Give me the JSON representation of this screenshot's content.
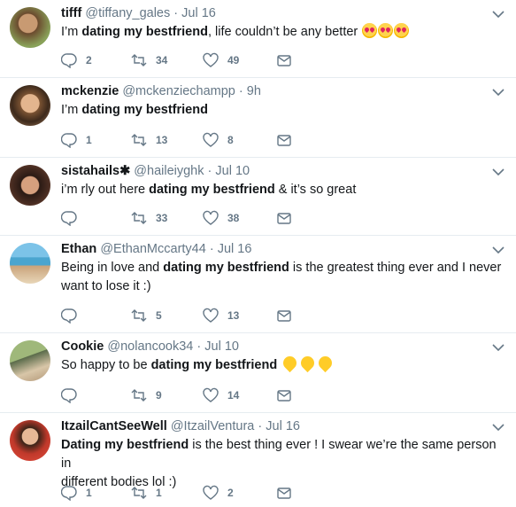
{
  "colors": {
    "accent": "#1da1f2",
    "muted": "#657786",
    "divider": "#e6ecf0",
    "heart_emoji": "#e0245e",
    "yellow_heart": "#ffcc28"
  },
  "tweets": [
    {
      "name": "tifff",
      "handle": "@tiffany_gales",
      "sep": "·",
      "time": "Jul 16",
      "text_before": "I’m ",
      "highlight": "dating my bestfriend",
      "text_after": ", life couldn’t be any better",
      "emoji": [
        "heart-eyes-emoji",
        "heart-eyes-emoji",
        "heart-eyes-emoji"
      ],
      "replies": "2",
      "retweets": "34",
      "likes": "49"
    },
    {
      "name": "mckenzie",
      "handle": "@mckenziechampp",
      "sep": "·",
      "time": "9h",
      "text_before": "I’m ",
      "highlight": "dating my bestfriend",
      "text_after": "",
      "replies": "1",
      "retweets": "13",
      "likes": "8"
    },
    {
      "name": "sistahails✱",
      "handle": "@haileiyghk",
      "sep": "·",
      "time": "Jul 10",
      "text_before": "i’m rly out here ",
      "highlight": "dating my bestfriend",
      "text_after": " & it’s so great",
      "replies": "",
      "retweets": "33",
      "likes": "38"
    },
    {
      "name": "Ethan",
      "handle": "@EthanMccarty44",
      "sep": "·",
      "time": "Jul 16",
      "text_before": "Being in love and ",
      "highlight": "dating my bestfriend",
      "text_after": " is the greatest thing ever and I never",
      "line2": "want to lose it :)",
      "replies": "",
      "retweets": "5",
      "likes": "13"
    },
    {
      "name": "Cookie",
      "handle": "@nolancook34",
      "sep": "·",
      "time": "Jul 10",
      "text_before": "So happy to be ",
      "highlight": "dating my bestfriend",
      "text_after": " ",
      "emoji": [
        "yellow-heart-emoji",
        "yellow-heart-emoji",
        "yellow-heart-emoji"
      ],
      "replies": "",
      "retweets": "9",
      "likes": "14"
    },
    {
      "name": "ItzailCantSeeWell",
      "handle": "@ItzailVentura",
      "sep": "·",
      "time": "Jul 16",
      "text_before": "",
      "highlight": "Dating my bestfriend",
      "text_after": " is the best thing ever ! I swear we’re the same person in",
      "line2": "different bodies lol :)",
      "replies": "1",
      "retweets": "1",
      "likes": "2"
    }
  ]
}
